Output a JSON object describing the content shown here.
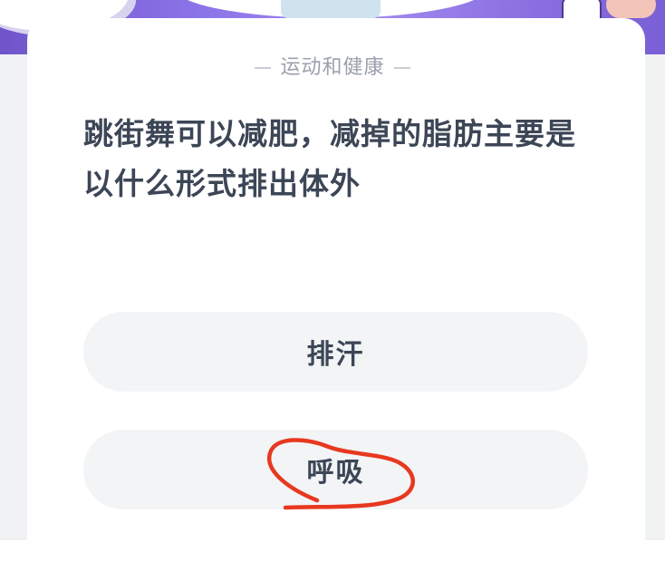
{
  "quiz": {
    "category": "运动和健康",
    "question": "跳街舞可以减肥，减掉的脂肪主要是以什么形式排出体外",
    "options": [
      {
        "label": "排汗"
      },
      {
        "label": "呼吸"
      }
    ],
    "circled_option_index": 1
  },
  "colors": {
    "banner": "#8b74e8",
    "card": "#ffffff",
    "option_bg": "#f2f4f6",
    "text": "#3c4656",
    "annotation": "#e8381f"
  }
}
